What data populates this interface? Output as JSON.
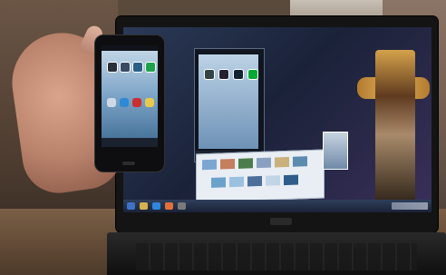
{
  "scene": {
    "description_label": ""
  },
  "colors": {
    "desk": "#7b5f46",
    "wallpaper": "#2b3a57",
    "phone_wallpaper": "#7ca4c7",
    "totem_gold": "#d4a24a"
  },
  "icons": {
    "phone_apps": [
      "camera-icon",
      "settings-icon",
      "music-icon",
      "browser-icon",
      "mail-icon",
      "gallery-icon",
      "maps-icon",
      "market-icon"
    ],
    "mirror_apps": [
      "camera-icon",
      "settings-icon",
      "music-icon",
      "browser-icon"
    ]
  }
}
